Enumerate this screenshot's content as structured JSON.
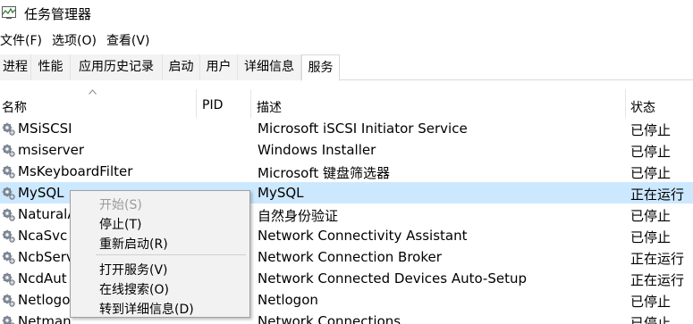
{
  "window": {
    "title": "任务管理器"
  },
  "menu": [
    "文件(F)",
    "选项(O)",
    "查看(V)"
  ],
  "tabs": [
    "进程",
    "性能",
    "应用历史记录",
    "启动",
    "用户",
    "详细信息",
    "服务"
  ],
  "active_tab": "服务",
  "columns": {
    "name": "名称",
    "pid": "PID",
    "desc": "描述",
    "status": "状态"
  },
  "rows": [
    {
      "name": "MSiSCSI",
      "pid": "",
      "desc": "Microsoft iSCSI Initiator Service",
      "status": "已停止"
    },
    {
      "name": "msiserver",
      "pid": "",
      "desc": "Windows Installer",
      "status": "已停止"
    },
    {
      "name": "MsKeyboardFilter",
      "pid": "",
      "desc": "Microsoft 键盘筛选器",
      "status": "已停止"
    },
    {
      "name": "MySQL",
      "pid": "",
      "desc": "MySQL",
      "status": "正在运行",
      "selected": true
    },
    {
      "name": "NaturalA",
      "pid": "",
      "desc": "自然身份验证",
      "status": "已停止"
    },
    {
      "name": "NcaSvc",
      "pid": "",
      "desc": "Network Connectivity Assistant",
      "status": "已停止"
    },
    {
      "name": "NcbServ",
      "pid": "",
      "desc": "Network Connection Broker",
      "status": "正在运行"
    },
    {
      "name": "NcdAut",
      "pid": "",
      "desc": "Network Connected Devices Auto-Setup",
      "status": "正在运行"
    },
    {
      "name": "Netlogo",
      "pid": "",
      "desc": "Netlogon",
      "status": "已停止"
    },
    {
      "name": "Netman",
      "pid": "",
      "desc": "Network Connections",
      "status": "已停止"
    }
  ],
  "context_menu": {
    "start": "开始(S)",
    "stop": "停止(T)",
    "restart": "重新启动(R)",
    "open_services": "打开服务(V)",
    "search_online": "在线搜索(O)",
    "goto_details": "转到详细信息(D)"
  },
  "colors": {
    "selection": "#cce8ff",
    "menu_bg": "#f2f2f2",
    "disabled_text": "#9b9b9b"
  }
}
